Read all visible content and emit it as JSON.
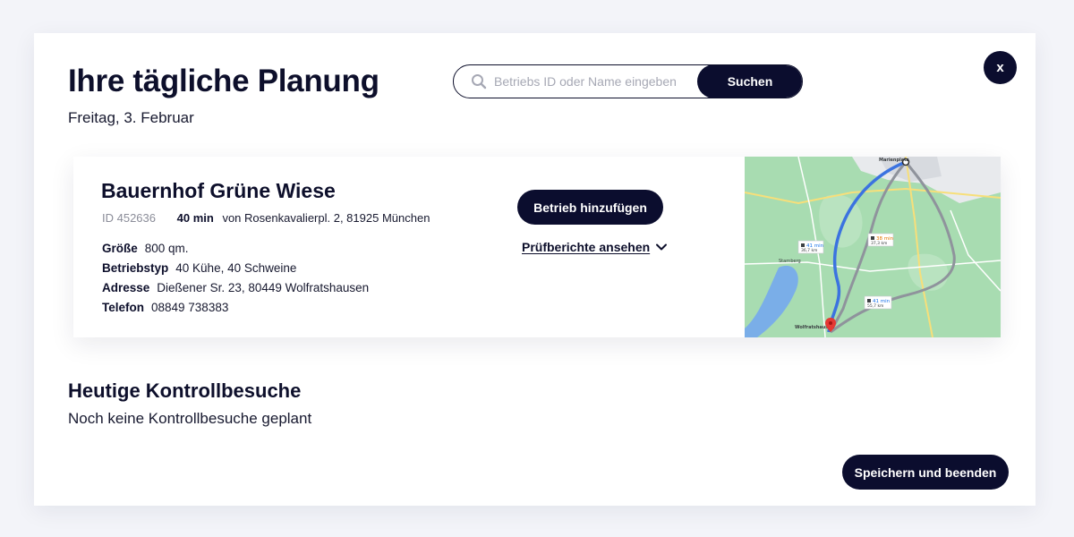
{
  "header": {
    "title": "Ihre tägliche Planung",
    "date": "Freitag, 3. Februar"
  },
  "search": {
    "placeholder": "Betriebs ID oder Name eingeben",
    "value": "",
    "button_label": "Suchen",
    "icon": "search-icon"
  },
  "close": {
    "label": "x",
    "icon": "close-icon"
  },
  "farm": {
    "name": "Bauernhof Grüne Wiese",
    "id_text": "ID 452636",
    "travel_time": "40 min",
    "from_text": "von Rosenkavalierpl. 2, 81925 München",
    "details": [
      {
        "label": "Größe",
        "value": "800 qm."
      },
      {
        "label": "Betriebstyp",
        "value": "40 Kühe, 40 Schweine"
      },
      {
        "label": "Adresse",
        "value": "Dießener Sr. 23, 80449 Wolfratshausen"
      },
      {
        "label": "Telefon",
        "value": "08849 738383"
      }
    ],
    "add_button_label": "Betrieb hinzufügen",
    "reports_link_label": "Prüfberichte ansehen",
    "reports_icon": "chevron-down-icon"
  },
  "map": {
    "labels": {
      "start": "Marienplatz",
      "destination": "Wolfratshausen",
      "starnberg": "Starnberg"
    },
    "routes": [
      {
        "time": "41 min",
        "distance": "36,7 km",
        "color": "#1a73e8"
      },
      {
        "time": "38 min",
        "distance": "37,3 km",
        "color": "#e37400"
      },
      {
        "time": "41 min",
        "distance": "55,7 km",
        "color": "#1a73e8"
      }
    ],
    "colors": {
      "land": "#a8dcb1",
      "water": "#7aaee8",
      "primary_route": "#3b73e0",
      "alt_route": "#8f939c",
      "pin": "#e53935"
    }
  },
  "visits": {
    "title": "Heutige Kontrollbesuche",
    "empty_text": "Noch keine Kontrollbesuche geplant"
  },
  "footer": {
    "save_button_label": "Speichern und beenden"
  },
  "theme": {
    "primary": "#0b0d2e",
    "background": "#f3f4f9",
    "surface": "#ffffff"
  }
}
